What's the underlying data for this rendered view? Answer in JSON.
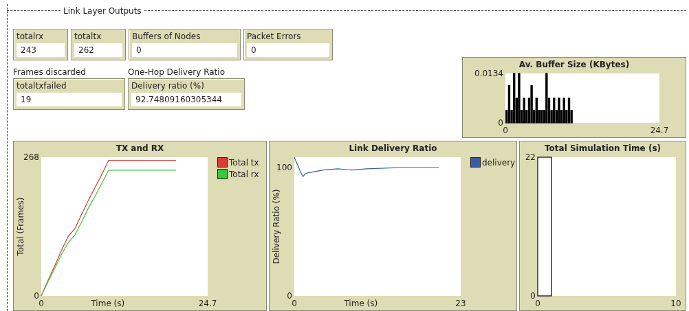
{
  "section": {
    "title": "Link Layer Outputs"
  },
  "monitors": [
    {
      "label": "totalrx",
      "value": "243"
    },
    {
      "label": "totaltx",
      "value": "262"
    },
    {
      "label": "Buffers of Nodes",
      "value": "0"
    },
    {
      "label": "Packet Errors",
      "value": "0"
    }
  ],
  "captioned_monitors": [
    {
      "caption": "Frames discarded",
      "label": "totaltxfailed",
      "value": "19"
    },
    {
      "caption": "One-Hop Delivery Ratio",
      "label": "Delivery ratio (%)",
      "value": "92.74809160305344"
    }
  ],
  "buffer_plot": {
    "title": "Av. Buffer Size (KBytes)",
    "chart_data": {
      "type": "bar",
      "xlim": [
        0,
        24.7
      ],
      "ylim": [
        0,
        0.0134
      ],
      "xticks": [
        0,
        24.7
      ],
      "yticks": [
        0,
        0.0134
      ],
      "x": [
        0.2,
        0.6,
        1,
        1.4,
        1.8,
        2.2,
        2.6,
        3,
        3.4,
        3.8,
        4.2,
        4.6,
        5,
        5.4,
        5.8,
        6.2,
        6.6,
        7,
        7.4,
        7.8,
        8.2,
        8.6,
        9,
        9.4,
        9.8,
        10.2,
        10.6
      ],
      "values": [
        0.0034,
        0.0101,
        0.0034,
        0.0134,
        0.0067,
        0.0134,
        0.0034,
        0.0067,
        0.0034,
        0.0067,
        0.0101,
        0.0034,
        0.0067,
        0.0034,
        0.0034,
        0.0034,
        0.0134,
        0.0067,
        0.0034,
        0.0067,
        0.0034,
        0.0067,
        0.0034,
        0.0067,
        0.0034,
        0.0067,
        0.0034
      ]
    }
  },
  "plots": [
    {
      "title": "TX and RX",
      "chart_data": {
        "type": "line",
        "xlabel": "Time (s)",
        "ylabel": "Total (Frames)",
        "xlim": [
          0,
          24.7
        ],
        "ylim": [
          0,
          268
        ],
        "xticks": [
          0,
          24.7
        ],
        "yticks": [
          0,
          268
        ],
        "series": [
          {
            "name": "Total tx",
            "color": "#d83a3a",
            "x": [
              0,
              1,
              2,
              3,
              4,
              5,
              6,
              7,
              8,
              9,
              10,
              20
            ],
            "values": [
              0,
              30,
              58,
              88,
              115,
              130,
              158,
              185,
              210,
              235,
              262,
              262
            ]
          },
          {
            "name": "Total rx",
            "color": "#3cc83c",
            "x": [
              0,
              1,
              2,
              3,
              4,
              5,
              6,
              7,
              8,
              9,
              10,
              20
            ],
            "values": [
              0,
              27,
              53,
              80,
              103,
              118,
              143,
              170,
              193,
              218,
              243,
              243
            ]
          }
        ]
      }
    },
    {
      "title": "Link Delivery Ratio",
      "chart_data": {
        "type": "line",
        "xlabel": "Time (s)",
        "ylabel": "Delivery Ratio (%)",
        "xlim": [
          0,
          23
        ],
        "ylim": [
          0,
          108
        ],
        "xticks": [
          0,
          23
        ],
        "yticks": [
          0,
          100
        ],
        "series": [
          {
            "name": "delivery",
            "color": "#3a5aa8",
            "x": [
              0,
              0.3,
              0.6,
              0.9,
              1.2,
              1.5,
              2,
              3,
              4,
              6,
              8,
              10,
              15,
              20
            ],
            "values": [
              108,
              104,
              100,
              96,
              93,
              95,
              96,
              97,
              98,
              99,
              98,
              99,
              100,
              100
            ]
          }
        ]
      }
    },
    {
      "title": "Total Simulation Time (s)",
      "chart_data": {
        "type": "bar",
        "xlim": [
          0,
          10
        ],
        "ylim": [
          0,
          22
        ],
        "xticks": [
          0,
          10
        ],
        "yticks": [
          0,
          22
        ],
        "x": [
          0.5
        ],
        "values": [
          22
        ]
      }
    }
  ]
}
